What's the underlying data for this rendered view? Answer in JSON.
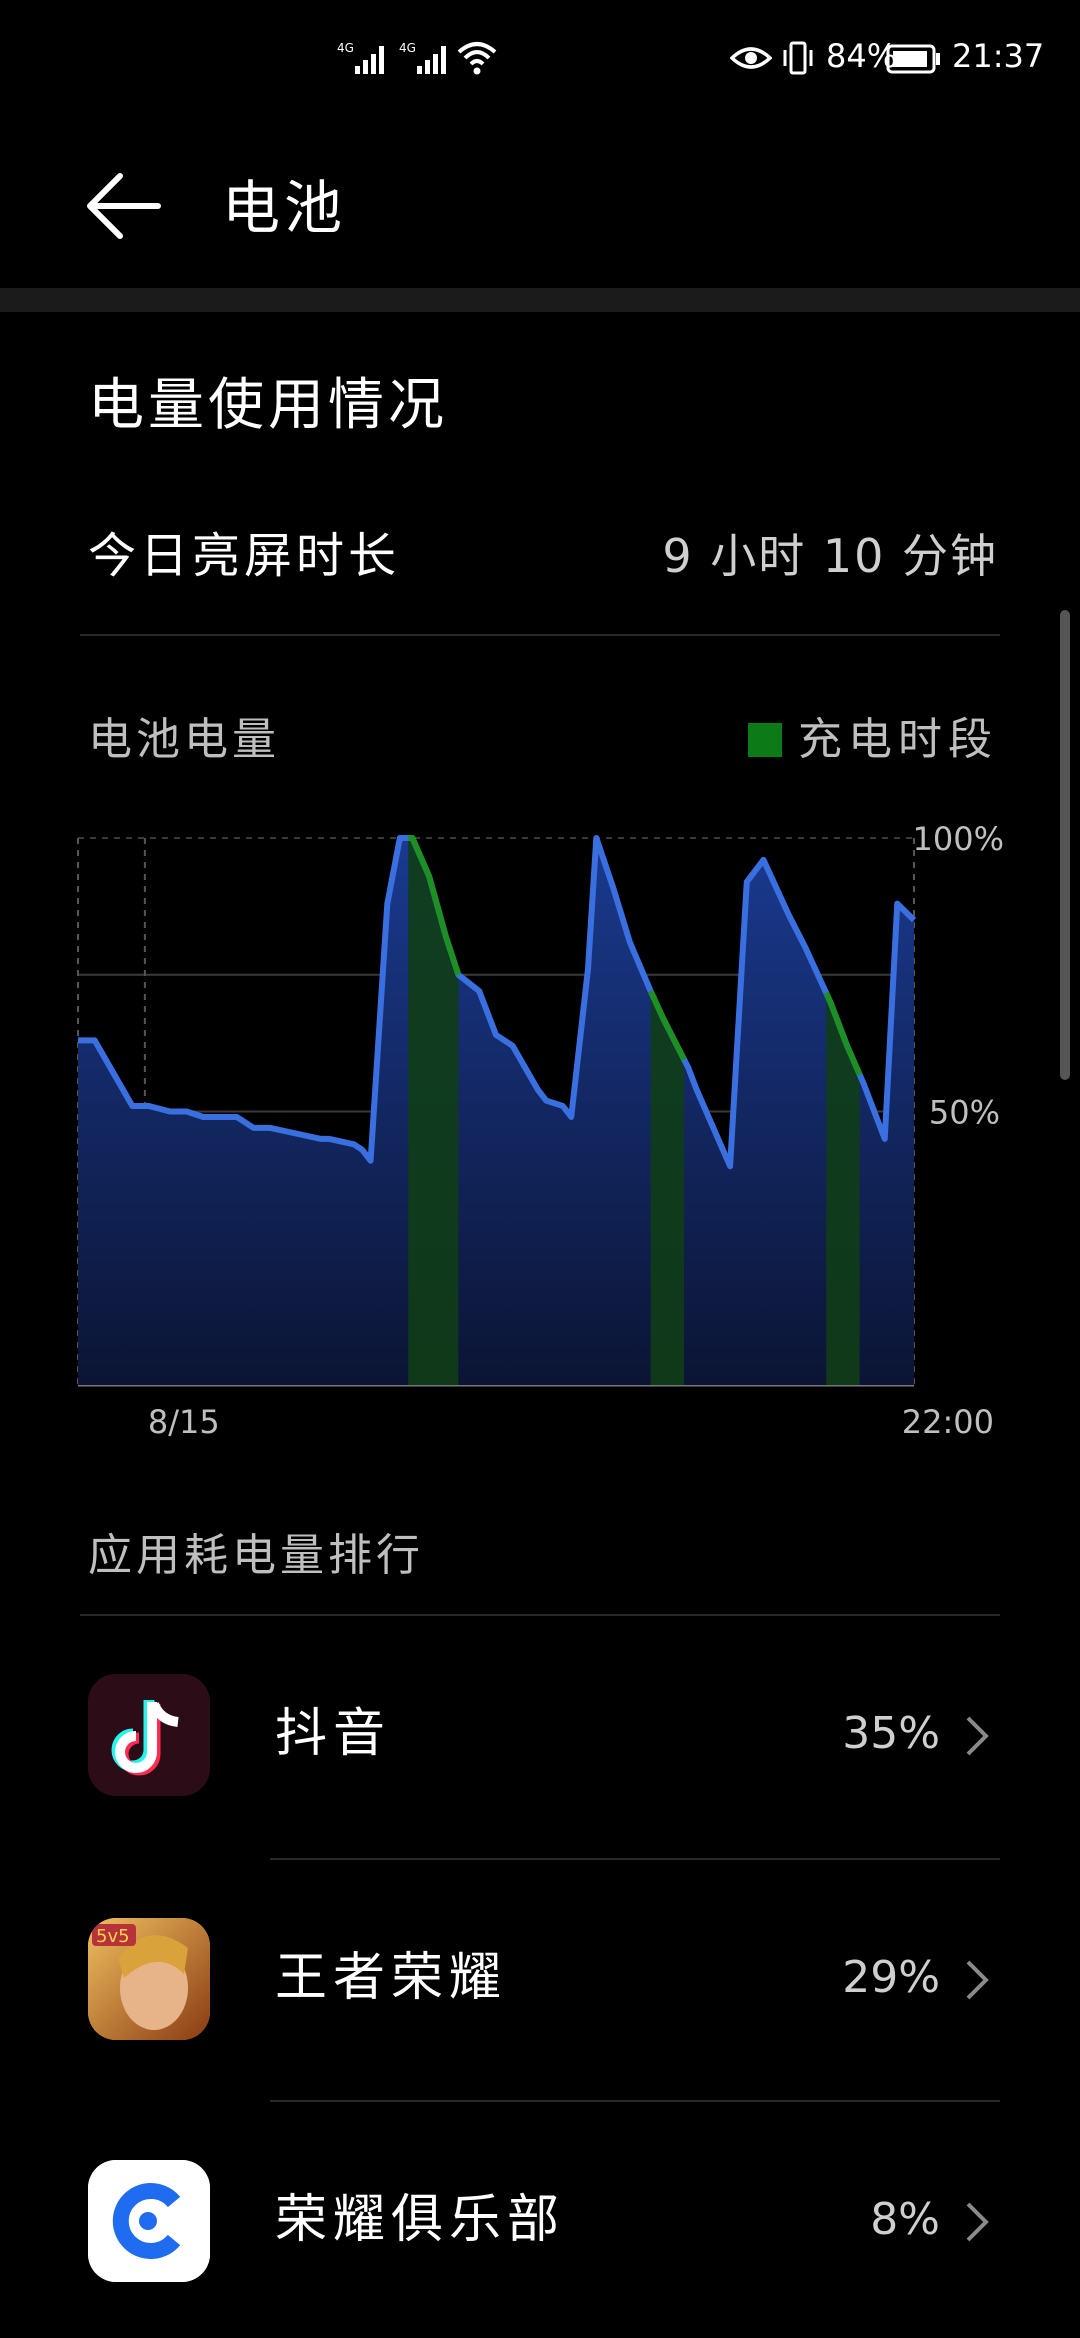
{
  "status_bar": {
    "network1": "4G",
    "network2": "4G",
    "battery_percent": "84%",
    "time": "21:37"
  },
  "header": {
    "title": "电池"
  },
  "usage": {
    "section_title": "电量使用情况",
    "screen_time_label": "今日亮屏时长",
    "screen_time_value": "9 小时 10 分钟"
  },
  "battery_chart": {
    "title": "电池电量",
    "legend_label": "充电时段",
    "y_labels": [
      "100%",
      "50%"
    ],
    "x_labels": [
      "8/15",
      "22:00"
    ],
    "colors": {
      "line": "#3a6fe0",
      "charging": "#1d8f25",
      "fill": "#14286a"
    }
  },
  "chart_data": {
    "type": "line",
    "title": "电池电量",
    "ylabel": "",
    "xlabel": "",
    "ylim": [
      0,
      100
    ],
    "x_ticks": [
      "8/15",
      "22:00"
    ],
    "y_ticks": [
      "50%",
      "100%"
    ],
    "series": [
      {
        "name": "",
        "x": [
          0.0,
          0.02,
          0.065,
          0.085,
          0.11,
          0.13,
          0.15,
          0.19,
          0.21,
          0.23,
          0.26,
          0.29,
          0.3,
          0.33,
          0.34,
          0.35,
          0.37,
          0.385,
          0.4,
          0.42,
          0.44,
          0.455,
          0.48,
          0.5,
          0.52,
          0.55,
          0.56,
          0.58,
          0.59,
          0.61,
          0.62,
          0.64,
          0.66,
          0.685,
          0.7,
          0.73,
          0.74,
          0.78,
          0.8,
          0.82,
          0.85,
          0.87,
          0.9,
          0.92,
          0.94,
          0.965,
          0.98,
          1.0
        ],
        "y": [
          63,
          63,
          51,
          51,
          50,
          50,
          49,
          49,
          47,
          47,
          46,
          45,
          45,
          44,
          43,
          41,
          88,
          100,
          100,
          93,
          82,
          75,
          72,
          64,
          62,
          54,
          52,
          51,
          49,
          76,
          100,
          91,
          81,
          72,
          67,
          58,
          54,
          40,
          92,
          96,
          86,
          80,
          70,
          62,
          55,
          45,
          88,
          85
        ],
        "charging": [
          [
            0.395,
            0.455
          ],
          [
            0.685,
            0.725
          ],
          [
            0.895,
            0.935
          ]
        ]
      }
    ],
    "legend": [
      "充电时段"
    ],
    "grid": true
  },
  "apps_section": {
    "title": "应用耗电量排行",
    "apps": [
      {
        "name": "抖音",
        "percent": "35%",
        "icon": "douyin-icon"
      },
      {
        "name": "王者荣耀",
        "percent": "29%",
        "icon": "honor-of-kings-icon"
      },
      {
        "name": "荣耀俱乐部",
        "percent": "8%",
        "icon": "honor-club-icon"
      }
    ]
  }
}
